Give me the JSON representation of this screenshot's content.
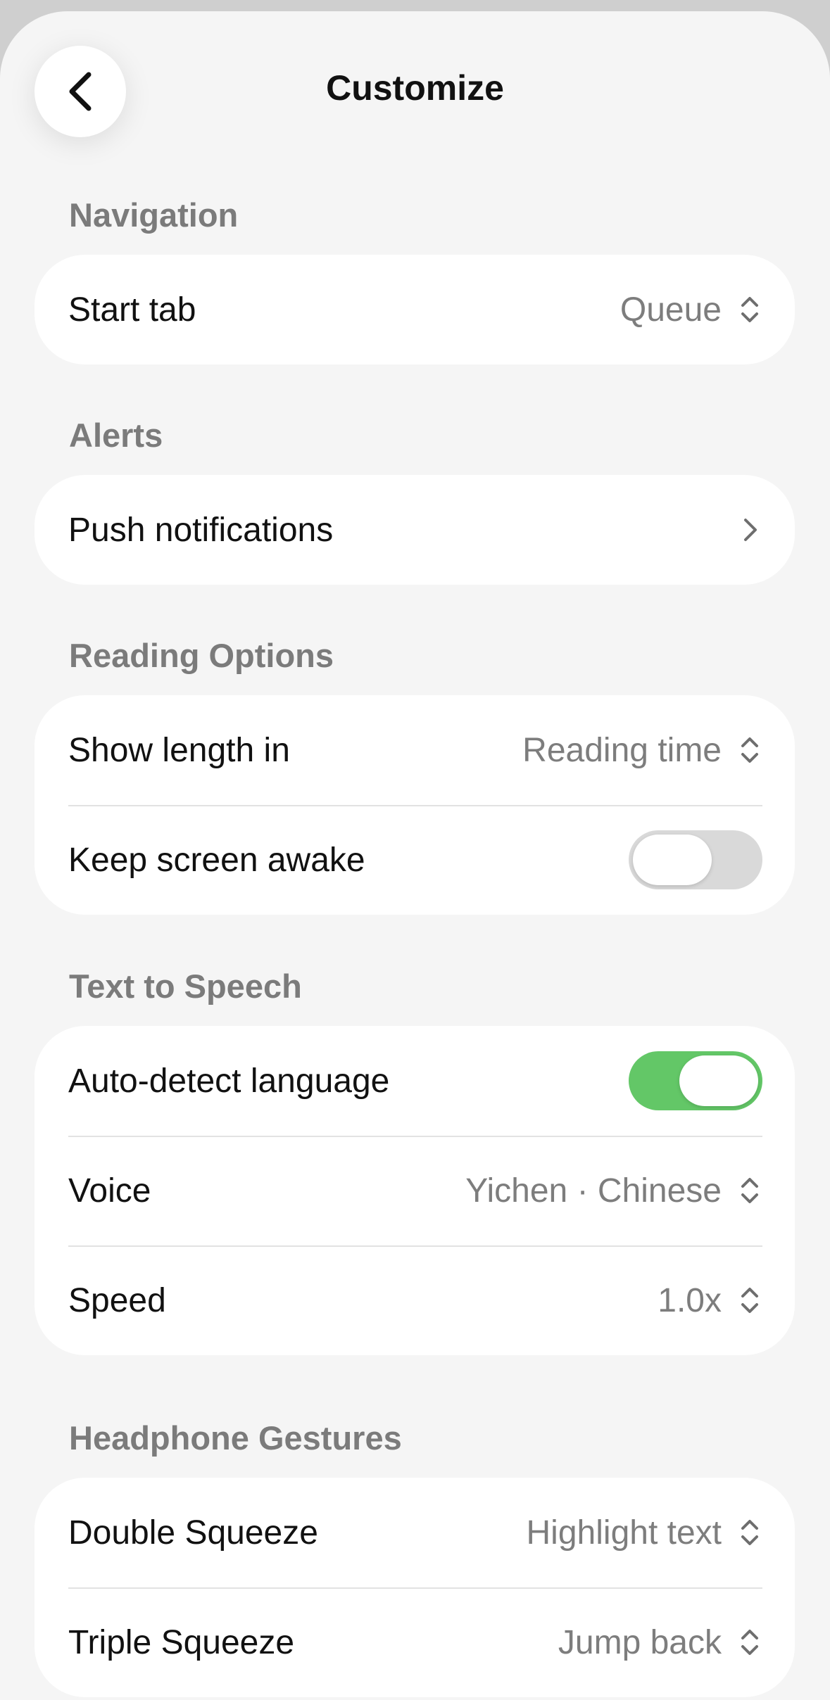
{
  "header": {
    "title": "Customize",
    "back_icon": "chevron-left-icon"
  },
  "sections": {
    "navigation": {
      "title": "Navigation",
      "start_tab": {
        "label": "Start tab",
        "value": "Queue"
      }
    },
    "alerts": {
      "title": "Alerts",
      "push_notifications": {
        "label": "Push notifications"
      }
    },
    "reading_options": {
      "title": "Reading Options",
      "show_length": {
        "label": "Show length in",
        "value": "Reading time"
      },
      "keep_awake": {
        "label": "Keep screen awake",
        "enabled": false
      }
    },
    "tts": {
      "title": "Text to Speech",
      "auto_detect": {
        "label": "Auto-detect language",
        "enabled": true
      },
      "voice": {
        "label": "Voice",
        "value": "Yichen · Chinese"
      },
      "speed": {
        "label": "Speed",
        "value": "1.0x"
      }
    },
    "headphone": {
      "title": "Headphone Gestures",
      "double_squeeze": {
        "label": "Double Squeeze",
        "value": "Highlight text"
      },
      "triple_squeeze": {
        "label": "Triple Squeeze",
        "value": "Jump back"
      }
    }
  },
  "colors": {
    "toggle_on": "#63c767",
    "toggle_off": "#d9d9d9",
    "background": "#f5f5f5"
  }
}
